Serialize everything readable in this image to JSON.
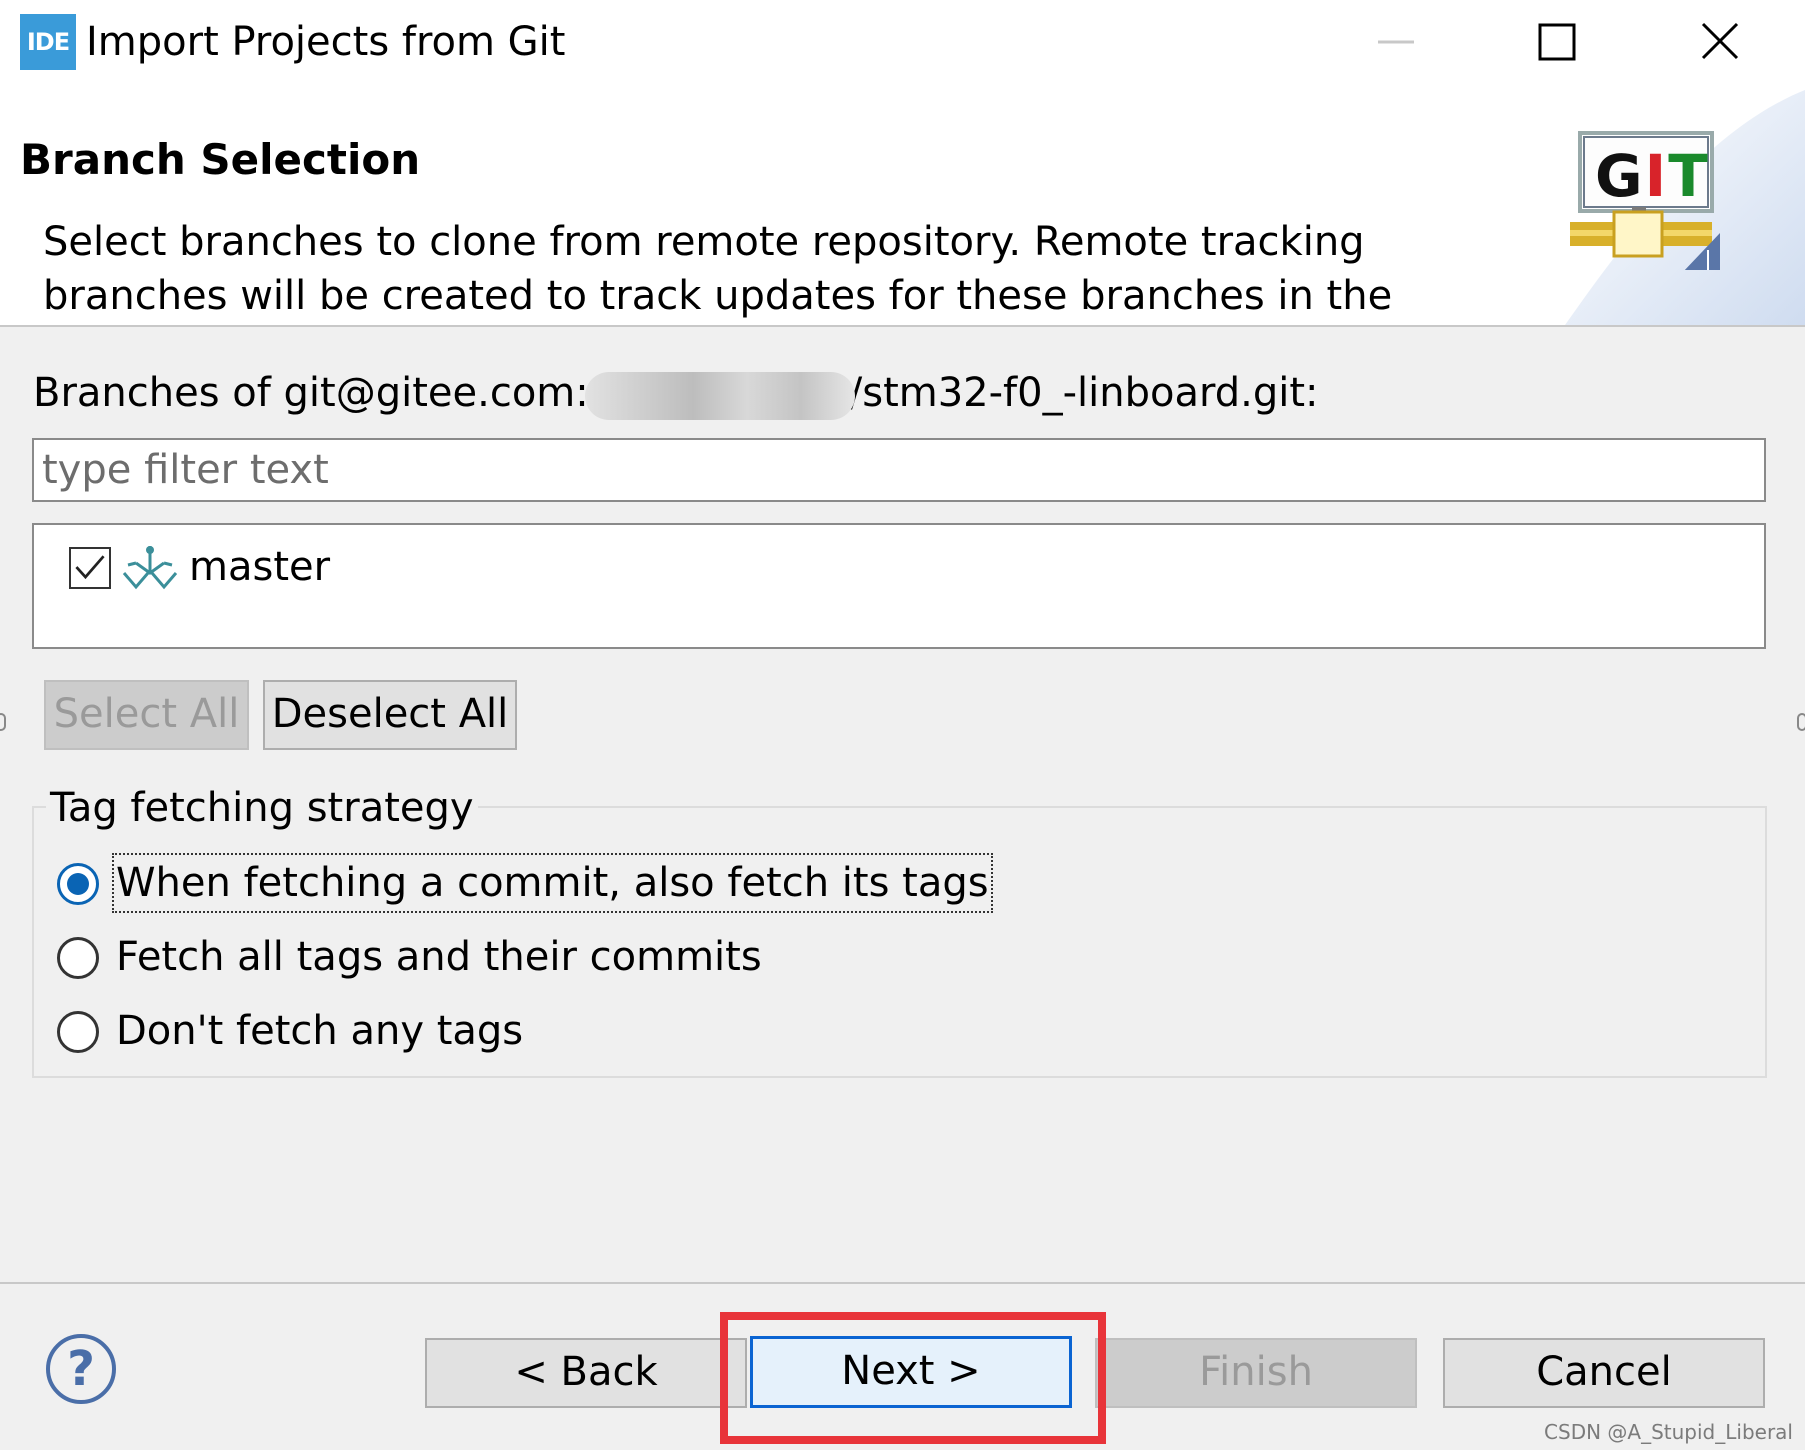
{
  "window": {
    "icon_text": "IDE",
    "title": "Import Projects from Git"
  },
  "header": {
    "heading": "Branch Selection",
    "description": "Select branches to clone from remote repository. Remote tracking branches will be created to track updates for these branches in the",
    "logo_text": "GIT"
  },
  "branches": {
    "label_prefix": "Branches of git@gitee.com:",
    "label_suffix": "/stm32-f0_-linboard.git:",
    "filter_placeholder": "type filter text",
    "items": [
      {
        "name": "master",
        "checked": true
      }
    ]
  },
  "buttons": {
    "select_all": "Select All",
    "deselect_all": "Deselect All",
    "back": "< Back",
    "next": "Next >",
    "finish": "Finish",
    "cancel": "Cancel"
  },
  "tag_fetching": {
    "legend": "Tag fetching strategy",
    "options": [
      {
        "label": "When fetching a commit, also fetch its tags",
        "selected": true
      },
      {
        "label": "Fetch all tags and their commits",
        "selected": false
      },
      {
        "label": "Don't fetch any tags",
        "selected": false
      }
    ]
  },
  "help_symbol": "?",
  "watermark": "CSDN @A_Stupid_Liberal",
  "colors": {
    "accent": "#0a64b4",
    "highlight": "#e8343a",
    "icon_blue": "#3a9bd9"
  }
}
